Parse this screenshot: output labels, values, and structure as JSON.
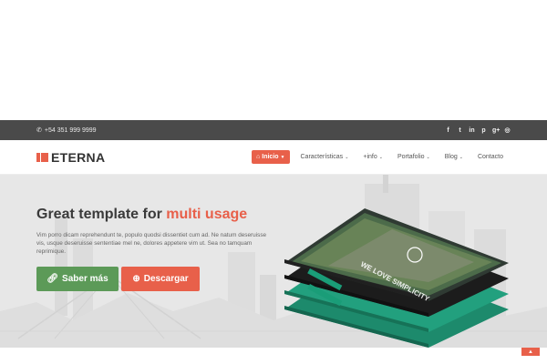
{
  "topbar": {
    "phone": "+54 351 999 9999",
    "social": [
      {
        "icon": "facebook-icon",
        "glyph": "f"
      },
      {
        "icon": "twitter-icon",
        "glyph": "t"
      },
      {
        "icon": "linkedin-icon",
        "glyph": "in"
      },
      {
        "icon": "pinterest-icon",
        "glyph": "p"
      },
      {
        "icon": "google-plus-icon",
        "glyph": "g+"
      },
      {
        "icon": "dribbble-icon",
        "glyph": "◎"
      }
    ]
  },
  "brand": {
    "name": "ETERNA",
    "accent_color": "#e8604a"
  },
  "nav": {
    "items": [
      {
        "label": "Inicio",
        "active": true,
        "icon": "home-icon",
        "caret": true
      },
      {
        "label": "Características",
        "caret": true
      },
      {
        "label": "+info",
        "caret": true
      },
      {
        "label": "Portafolio",
        "caret": true
      },
      {
        "label": "Blog",
        "caret": true
      },
      {
        "label": "Contacto",
        "caret": false
      }
    ]
  },
  "hero": {
    "title_start": "Great template for",
    "title_accent": "multi usage",
    "text": "Vim porro dicam reprehendunt te, populo quodsi dissentiet cum ad. Ne natum deseruisse vis, usque deseruisse sententiae mel ne, dolores appetere vim ut. Sea no tamquam reprimique.",
    "buttons": [
      {
        "label": "Saber más",
        "icon": "link-icon",
        "color": "#5c9a58"
      },
      {
        "label": "Descargar",
        "icon": "download-icon",
        "color": "#e8604a"
      }
    ],
    "mockup_text": "WE LOVE SIMPLICITY"
  }
}
